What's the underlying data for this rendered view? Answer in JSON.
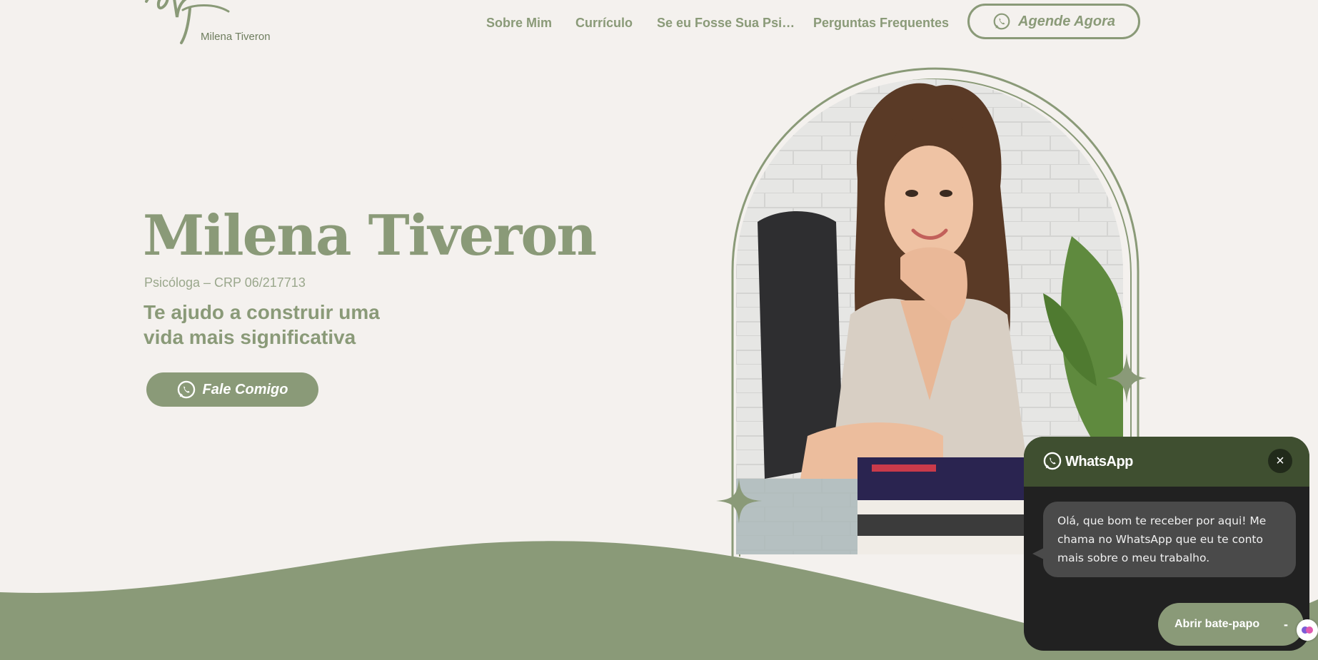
{
  "brand": {
    "logo_text": "Milena Tiveron"
  },
  "nav": {
    "items": [
      "Sobre Mim",
      "Currículo",
      "Se eu Fosse Sua Psi…",
      "Perguntas Frequentes"
    ],
    "cta_label": "Agende Agora"
  },
  "hero": {
    "name": "Milena Tiveron",
    "subtitle": "Psicóloga – CRP 06/217713",
    "tagline_line1": "Te ajudo a construir uma",
    "tagline_line2": "vida mais significativa",
    "cta_label": "Fale Comigo"
  },
  "whatsapp_widget": {
    "title": "WhatsApp",
    "close_label": "×",
    "message": "Olá, que bom te receber por aqui! Me chama no WhatsApp que eu te conto mais sobre o meu trabalho.",
    "open_label": "Abrir bate-papo",
    "minimize_label": "-"
  },
  "colors": {
    "accent": "#8a9a78",
    "background": "#f4f1ee",
    "widget_header": "#3f4f30",
    "widget_body": "#212121"
  }
}
